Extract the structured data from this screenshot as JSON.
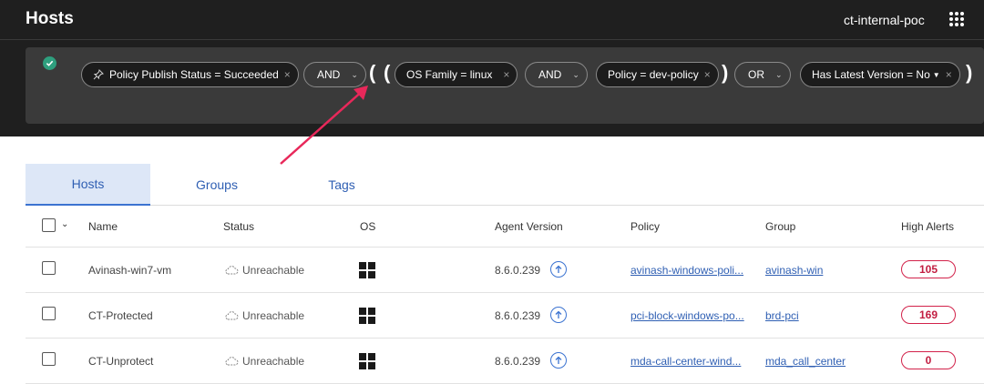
{
  "header": {
    "title": "Hosts",
    "org": "ct-internal-poc",
    "apps_icon": "grid-apps-icon"
  },
  "filters": {
    "status_icon": "check-circle-icon",
    "chip1": {
      "label": "Policy Publish Status =",
      "value": "Succeeded"
    },
    "op1": "AND",
    "chip2": {
      "label": "OS Family =",
      "value": "linux"
    },
    "op2": "AND",
    "chip3": {
      "label": "Policy =",
      "value": "dev-policy"
    },
    "op3": "OR",
    "chip4": {
      "label": "Has Latest Version =",
      "value": "No"
    },
    "paren_open": "(",
    "paren_close": ")",
    "remove": "×"
  },
  "tabs": [
    "Hosts",
    "Groups",
    "Tags"
  ],
  "table": {
    "headers": [
      "Name",
      "Status",
      "OS",
      "Agent Version",
      "Policy",
      "Group",
      "High Alerts"
    ],
    "rows": [
      {
        "name": "Avinash-win7-vm",
        "status": "Unreachable",
        "os": "windows-icon",
        "version": "8.6.0.239",
        "policy": "avinash-windows-poli...",
        "group": "avinash-win",
        "alerts": "105"
      },
      {
        "name": "CT-Protected",
        "status": "Unreachable",
        "os": "windows-icon",
        "version": "8.6.0.239",
        "policy": "pci-block-windows-po...",
        "group": "brd-pci",
        "alerts": "169"
      },
      {
        "name": "CT-Unprotect",
        "status": "Unreachable",
        "os": "windows-icon",
        "version": "8.6.0.239",
        "policy": "mda-call-center-wind...",
        "group": "mda_call_center",
        "alerts": "0"
      }
    ]
  },
  "colors": {
    "accent": "#3b73d1",
    "alert": "#d2224a",
    "success": "#2e9f7e",
    "dark": "#1f1f1f"
  }
}
